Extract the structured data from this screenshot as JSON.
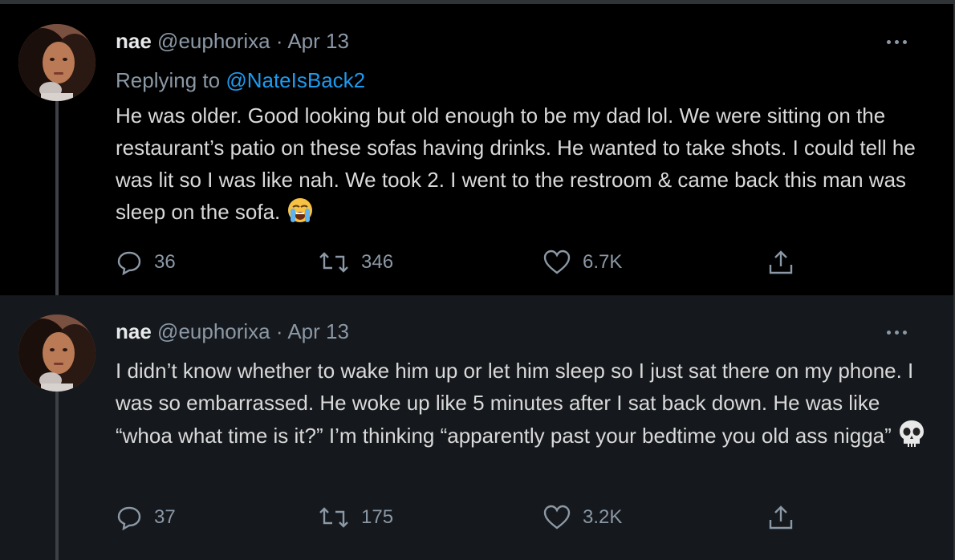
{
  "tweets": [
    {
      "author_name": "nae",
      "handle": "@euphorixa",
      "separator": "·",
      "date": "Apr 13",
      "replying_prefix": "Replying to",
      "replying_to": "@NateIsBack2",
      "text": "He was older. Good looking but old enough to be my dad lol. We were sitting on the restaurant’s patio on these sofas having drinks. He wanted to take shots. I could tell he was lit so I was like nah. We took 2. I went to the restroom & came back this man was sleep on the sofa.",
      "emoji": "loudly-crying-face",
      "replies": "36",
      "retweets": "346",
      "likes": "6.7K"
    },
    {
      "author_name": "nae",
      "handle": "@euphorixa",
      "separator": "·",
      "date": "Apr 13",
      "text": "I didn’t know whether to wake him up or let him sleep so I just sat there on my phone. I was so embarrassed. He woke up like 5 minutes after I sat back down. He was like “whoa what time is it?” I’m thinking “apparently past your bedtime you old ass nigga”",
      "emoji": "skull",
      "replies": "37",
      "retweets": "175",
      "likes": "3.2K"
    }
  ],
  "icons": {
    "reply": "reply-icon",
    "retweet": "retweet-icon",
    "like": "heart-icon",
    "share": "share-icon",
    "more": "more-icon"
  },
  "colors": {
    "background": "#000000",
    "reply_background": "#15181c",
    "secondary_text": "#8b98a5",
    "link": "#1d9bf0",
    "primary_text": "#d9d9d9"
  }
}
